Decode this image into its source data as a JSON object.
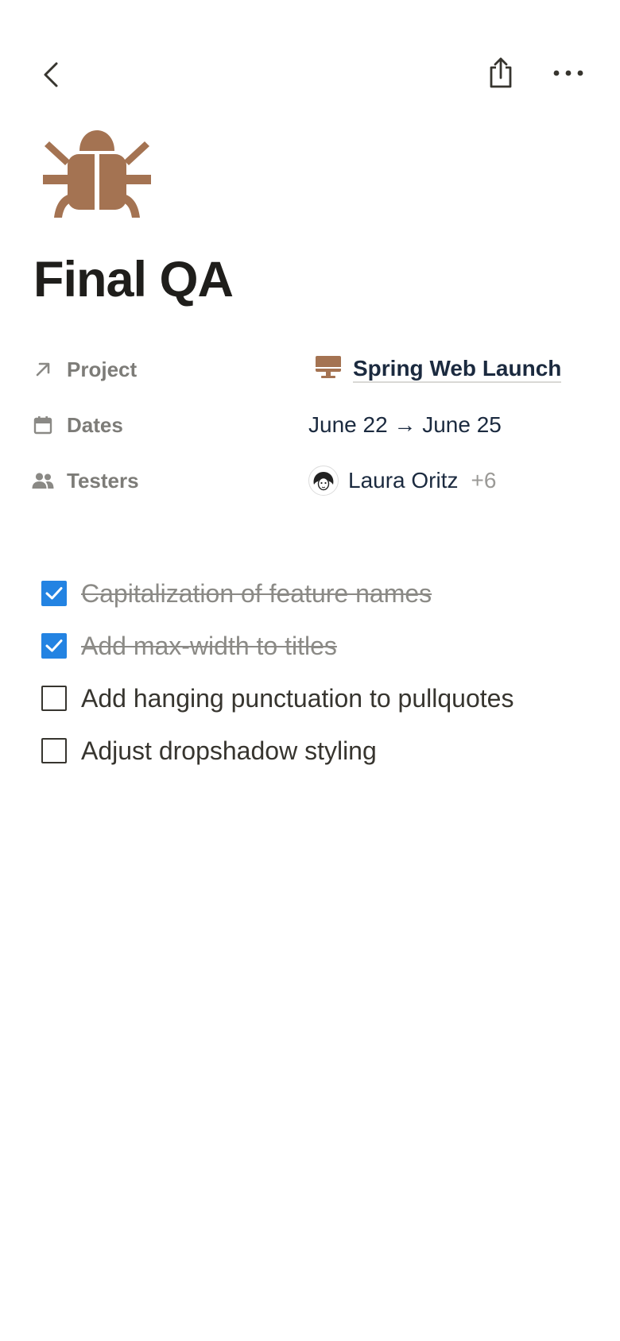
{
  "nav": {
    "back_icon": "chevron-left-icon",
    "share_icon": "share-icon",
    "more_icon": "more-horizontal-icon"
  },
  "page": {
    "icon": "bug-icon",
    "icon_color": "#A47352",
    "title": "Final QA"
  },
  "properties": {
    "project": {
      "label": "Project",
      "icon": "arrow-up-right-icon",
      "value_icon": "desktop-monitor-icon",
      "value": "Spring Web Launch"
    },
    "dates": {
      "label": "Dates",
      "icon": "calendar-icon",
      "value": "June 22 → June 25"
    },
    "testers": {
      "label": "Testers",
      "icon": "people-icon",
      "person": "Laura Oritz",
      "more": "+6"
    }
  },
  "todos": [
    {
      "text": "Capitalization of feature names",
      "checked": true
    },
    {
      "text": "Add max-width to titles",
      "checked": true
    },
    {
      "text": "Add hanging punctuation to pullquotes",
      "checked": false
    },
    {
      "text": "Adjust dropshadow styling",
      "checked": false
    }
  ],
  "colors": {
    "checkbox_checked": "#2383E2",
    "text_primary": "#37352F",
    "text_secondary": "#7D7C78"
  }
}
